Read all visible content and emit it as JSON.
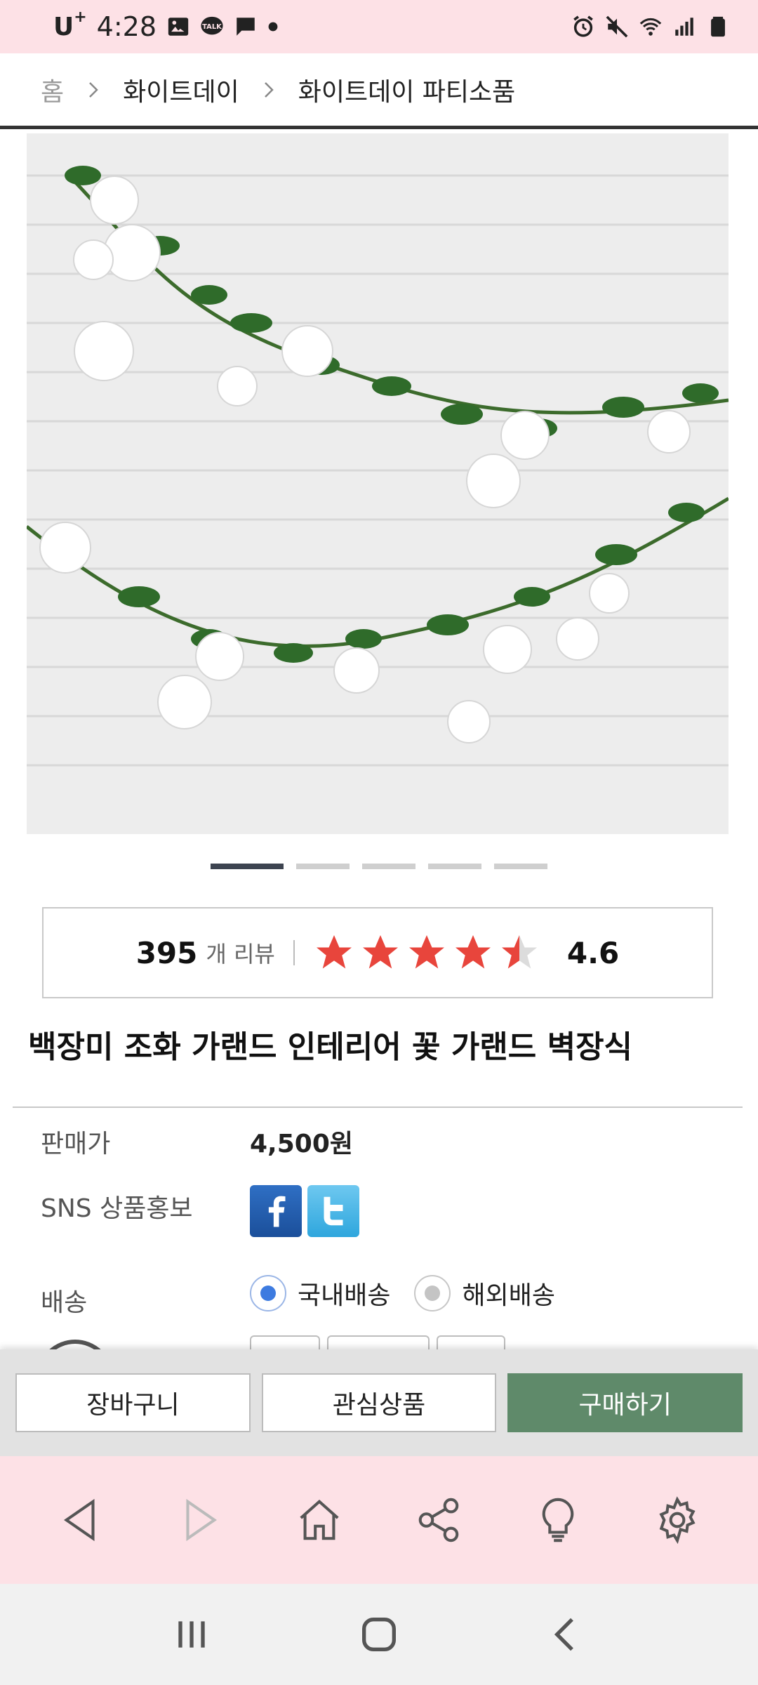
{
  "status_bar": {
    "carrier": "U",
    "carrier_sup": "+",
    "time": "4:28",
    "icons": [
      "image-icon",
      "kakaotalk-icon",
      "message-icon",
      "dot-icon",
      "alarm-icon",
      "mute-icon",
      "wifi-icon",
      "signal-icon",
      "battery-icon"
    ]
  },
  "breadcrumb": {
    "home": "홈",
    "level1": "화이트데이",
    "level2": "화이트데이 파티소품"
  },
  "product_image": {
    "alt": "white-rose-garland-on-brick-wall",
    "colors": {
      "wall": "#ececec",
      "brick_line": "#d9d9d9",
      "leaf": "#2f6b2a",
      "rose": "#ffffff"
    }
  },
  "gallery": {
    "total": 5,
    "active": 1
  },
  "review": {
    "count": "395",
    "unit": "개 리뷰",
    "rating": "4.6",
    "rating_value": 4.6,
    "star_color": "#e8453c"
  },
  "product": {
    "title": "백장미 조화 가랜드 인테리어 꽃 가랜드 벽장식"
  },
  "info": {
    "price_label": "판매가",
    "price_value": "4,500원",
    "sns_label": "SNS 상품홍보",
    "shipping_label": "배송",
    "shipping_options": [
      "국내배송",
      "해외배송"
    ],
    "shipping_selected": "국내배송"
  },
  "actions": {
    "cart": "장바구니",
    "wishlist": "관심상품",
    "buy": "구매하기",
    "buy_color": "#5f8a6a"
  },
  "browser_toolbar": {
    "buttons": [
      "back-icon",
      "forward-icon",
      "home-icon",
      "share-icon",
      "lightbulb-icon",
      "settings-icon"
    ]
  },
  "system_nav": {
    "buttons": [
      "recents-icon",
      "home-icon",
      "back-icon"
    ]
  }
}
